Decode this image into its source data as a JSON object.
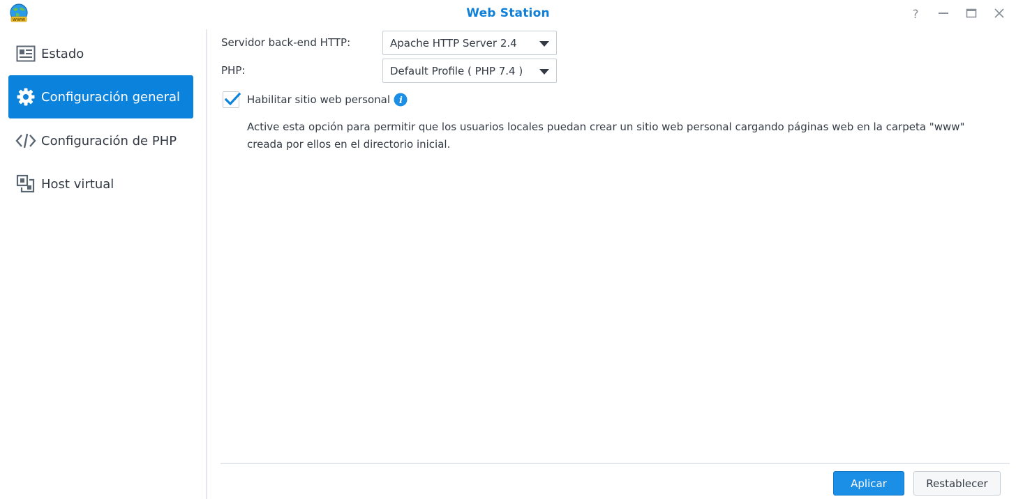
{
  "window": {
    "title": "Web Station",
    "controls": [
      "help-icon",
      "minimize-icon",
      "maximize-icon",
      "close-icon"
    ]
  },
  "sidebar": {
    "items": [
      {
        "label": "Estado",
        "icon": "status-card-icon",
        "active": false
      },
      {
        "label": "Configuración general",
        "icon": "gear-icon",
        "active": true
      },
      {
        "label": "Configuración de PHP",
        "icon": "code-icon",
        "active": false
      },
      {
        "label": "Host virtual",
        "icon": "virtual-host-icon",
        "active": false
      }
    ]
  },
  "main": {
    "backend": {
      "label": "Servidor back-end HTTP:",
      "value": "Apache HTTP Server 2.4"
    },
    "php": {
      "label": "PHP:",
      "value": "Default Profile ( PHP 7.4 )"
    },
    "personal_site": {
      "label": "Habilitar sitio web personal",
      "checked": true,
      "description": "Active esta opción para permitir que los usuarios locales puedan crear un sitio web personal cargando páginas web en la carpeta \"www\" creada por ellos en el directorio inicial."
    }
  },
  "footer": {
    "apply_label": "Aplicar",
    "reset_label": "Restablecer"
  },
  "colors": {
    "accent": "#0b82dc",
    "title": "#0f7fd8",
    "text": "#333a44"
  }
}
